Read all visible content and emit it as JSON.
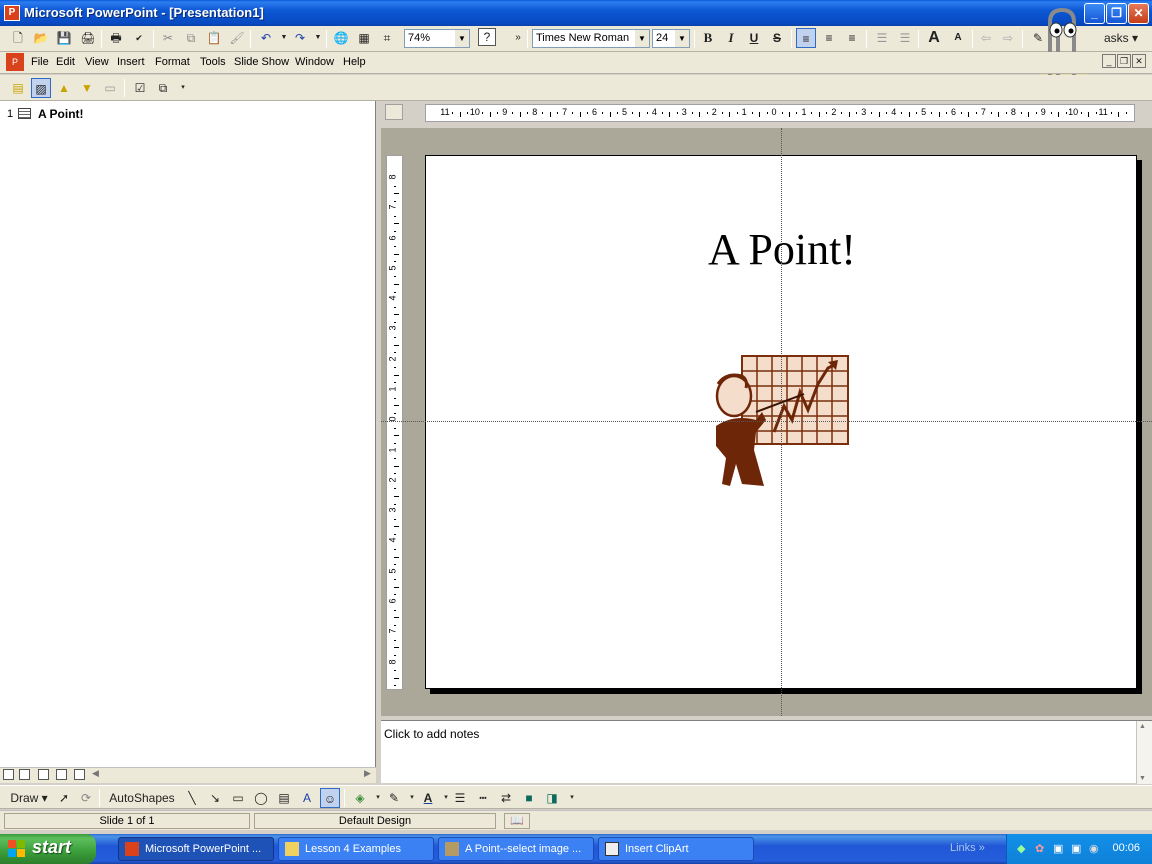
{
  "window": {
    "title": "Microsoft PowerPoint - [Presentation1]",
    "app_icon": "powerpoint-icon"
  },
  "standard_toolbar": {
    "zoom": "74%",
    "font_name": "Times New Roman",
    "font_size": "24",
    "bold": "B",
    "italic": "I",
    "underline": "U",
    "shadow": "S",
    "tasks_label": "asks"
  },
  "menu": {
    "items": [
      "File",
      "Edit",
      "View",
      "Insert",
      "Format",
      "Tools",
      "Slide Show",
      "Window",
      "Help"
    ]
  },
  "outline": {
    "slide_number": "1",
    "slide_title": "A Point!"
  },
  "rulers": {
    "horizontal": [
      "11",
      "10",
      "9",
      "8",
      "7",
      "6",
      "5",
      "4",
      "3",
      "2",
      "1",
      "0",
      "1",
      "2",
      "3",
      "4",
      "5",
      "6",
      "7",
      "8",
      "9",
      "10",
      "11"
    ],
    "vertical": [
      "8",
      "7",
      "6",
      "5",
      "4",
      "3",
      "2",
      "1",
      "0",
      "1",
      "2",
      "3",
      "4",
      "5",
      "6",
      "7",
      "8"
    ]
  },
  "slide": {
    "title": "A Point!",
    "clipart": "businessman-pointing-at-chart"
  },
  "notes": {
    "placeholder": "Click to add notes"
  },
  "drawing_toolbar": {
    "draw_label": "Draw",
    "autoshapes_label": "AutoShapes"
  },
  "status": {
    "slide_position": "Slide 1 of 1",
    "design": "Default Design"
  },
  "taskbar": {
    "start_label": "start",
    "tasks": [
      {
        "label": "Microsoft PowerPoint ...",
        "icon": "powerpoint-icon",
        "active": true
      },
      {
        "label": "Lesson 4 Examples",
        "icon": "folder-icon",
        "active": false
      },
      {
        "label": "A Point--select image ...",
        "icon": "paint-icon",
        "active": false
      },
      {
        "label": "Insert ClipArt",
        "icon": "clipart-icon",
        "active": false
      }
    ],
    "links_label": "Links",
    "clock": "00:06"
  }
}
